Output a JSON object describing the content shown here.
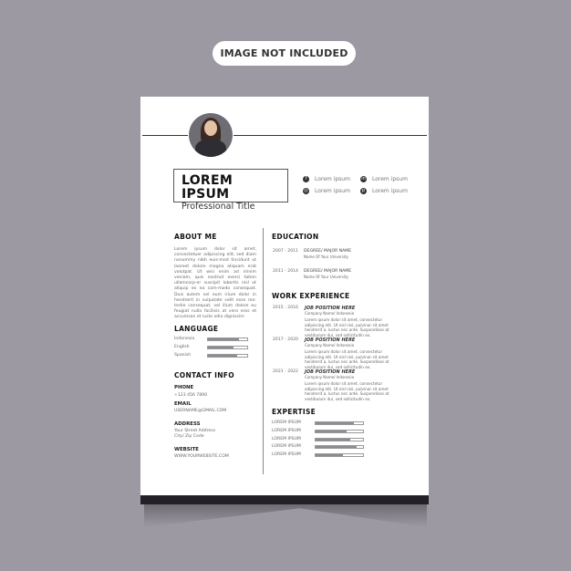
{
  "badge": "IMAGE NOT INCLUDED",
  "header": {
    "name": "LOREM IPSUM",
    "title": "Professional Title",
    "social": [
      {
        "icon": "facebook-icon",
        "label": "Lorem ipsum"
      },
      {
        "icon": "linkedin-icon",
        "label": "Lorem ipsum"
      },
      {
        "icon": "instagram-icon",
        "label": "Lorem ipsum"
      },
      {
        "icon": "pinterest-icon",
        "label": "Lorem ipsum"
      }
    ]
  },
  "about": {
    "heading": "ABOUT ME",
    "text": "Lorem ipsum dolor sit amet, consectetuer adipiscing elit, sed diam nonummy nibh euis-mod tincidunt ut laoreet dolore magna aliquam erat volutpat. Ut wisi enim ad minim veniam, quis nostrud exerci tation ullamcorp-er suscipit lobortis nisl ut aliquip ex ea com-modo consequat. Duis autem vel eum iriure dolor in hendrerit in vulputate velit esse mo-lestie consequat, vel illum dolore eu feugiat nulla facilisis at vero eros et accumsan et iusto odio dignissim"
  },
  "language": {
    "heading": "LANGUAGE",
    "items": [
      {
        "name": "Indonesia",
        "level": 0.78
      },
      {
        "name": "English",
        "level": 0.65
      },
      {
        "name": "Spanish",
        "level": 0.75
      }
    ]
  },
  "contact": {
    "heading": "CONTACT INFO",
    "phone_label": "PHONE",
    "phone": "+123 456 7890",
    "email_label": "EMAIL",
    "email": "USERNAME@GMAIL.COM",
    "address_label": "ADDRESS",
    "address1": "Your Street Address",
    "address2": "City/ Zip Code",
    "website_label": "WEBSITE",
    "website": "WWW.YOURWEBSITE.COM"
  },
  "education": {
    "heading": "EDUCATION",
    "items": [
      {
        "years": "2007 - 2011",
        "degree": "DEGREE/ MAJOR NAME",
        "school": "Name Of Your University"
      },
      {
        "years": "2011 - 2014",
        "degree": "DEGREE/ MAJOR NAME",
        "school": "Name Of Your University"
      }
    ]
  },
  "work": {
    "heading": "WORK EXPERIENCE",
    "items": [
      {
        "years": "2015 - 2016",
        "position": "JOB POSITION HERE",
        "company": "Company Name/ Indonesia",
        "desc": "Lorem ipsum dolor sit amet, consectetur adipiscing elit. Ut nisl nisl, pulvinar sit amet hendrerit a, luctus nec ante. Suspendisse at vestibulum dui, sed sollicitudin ex."
      },
      {
        "years": "2017 - 2020",
        "position": "JOB POSITION HERE",
        "company": "Company Name/ Indonesia",
        "desc": "Lorem ipsum dolor sit amet, consectetur adipiscing elit. Ut nisl nisl, pulvinar sit amet hendrerit a, luctus nec ante. Suspendisse at vestibulum dui, sed sollicitudin ex."
      },
      {
        "years": "2021 - 2022",
        "position": "JOB POSITION HERE",
        "company": "Company Name/ Indonesia",
        "desc": "Lorem ipsum dolor sit amet, consectetur adipiscing elit. Ut nisl nisl, pulvinar sit amet hendrerit a, luctus nec ante. Suspendisse at vestibulum dui, sed sollicitudin ex."
      }
    ]
  },
  "expertise": {
    "heading": "EXPERTISE",
    "items": [
      {
        "name": "LOREM IPSUM",
        "level": 0.8
      },
      {
        "name": "LOREM IPSUM",
        "level": 0.65
      },
      {
        "name": "LOREM IPSUM",
        "level": 0.73
      },
      {
        "name": "LOREM IPSUM",
        "level": 0.87
      },
      {
        "name": "LOREM IPSUM",
        "level": 0.57
      }
    ]
  }
}
